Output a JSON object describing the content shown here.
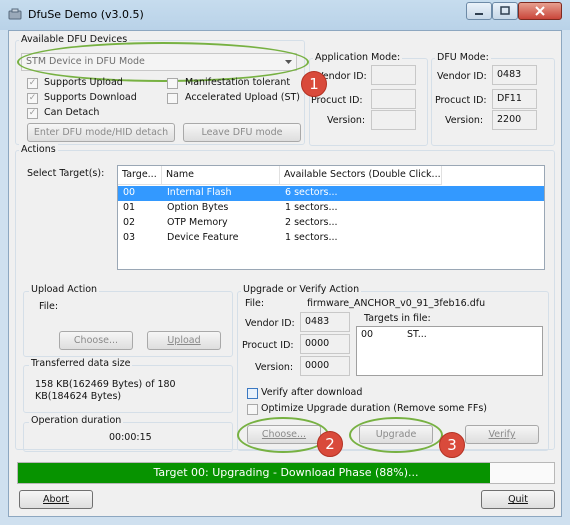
{
  "window": {
    "title": "DfuSe Demo (v3.0.5)"
  },
  "dfu_devices": {
    "group_title": "Available DFU Devices",
    "selected_device": "STM Device in DFU Mode",
    "supports_upload": "Supports Upload",
    "supports_download": "Supports Download",
    "can_detach": "Can Detach",
    "manifestation_tolerant": "Manifestation tolerant",
    "accelerated_upload": "Accelerated Upload (ST)",
    "enter_dfu_button": "Enter DFU mode/HID detach",
    "leave_dfu_button": "Leave DFU mode"
  },
  "application_mode": {
    "title": "Application Mode:",
    "vendor_id_label": "Vendor ID:",
    "product_id_label": "Procuct ID:",
    "version_label": "Version:",
    "vendor_id": "",
    "product_id": "",
    "version": ""
  },
  "dfu_mode": {
    "title": "DFU Mode:",
    "vendor_id_label": "Vendor ID:",
    "product_id_label": "Procuct ID:",
    "version_label": "Version:",
    "vendor_id": "0483",
    "product_id": "DF11",
    "version": "2200"
  },
  "actions": {
    "group_title": "Actions",
    "select_target_label": "Select Target(s):",
    "columns": [
      "Targe...",
      "Name",
      "Available Sectors (Double Click..."
    ],
    "targets": [
      {
        "id": "00",
        "name": "Internal Flash",
        "sectors": "6 sectors..."
      },
      {
        "id": "01",
        "name": "Option Bytes",
        "sectors": "1 sectors..."
      },
      {
        "id": "02",
        "name": "OTP Memory",
        "sectors": "2 sectors..."
      },
      {
        "id": "03",
        "name": "Device Feature",
        "sectors": "1 sectors..."
      }
    ]
  },
  "upload": {
    "group_title": "Upload Action",
    "file_label": "File:",
    "choose_button": "Choose...",
    "upload_button": "Upload"
  },
  "transferred": {
    "group_title": "Transferred data size",
    "text": "158 KB(162469 Bytes) of 180 KB(184624 Bytes)"
  },
  "duration": {
    "group_title": "Operation duration",
    "value": "00:00:15"
  },
  "upgrade": {
    "group_title": "Upgrade or Verify Action",
    "file_label": "File:",
    "file_name": "firmware_ANCHOR_v0_91_3feb16.dfu",
    "vendor_id_label": "Vendor ID:",
    "vendor_id": "0483",
    "product_id_label": "Procuct ID:",
    "product_id": "0000",
    "version_label": "Version:",
    "version": "0000",
    "targets_in_file_label": "Targets in file:",
    "targets_in_file": [
      {
        "id": "00",
        "name": "ST..."
      }
    ],
    "verify_after_download": "Verify after download",
    "optimize_upgrade": "Optimize Upgrade duration (Remove some FFs)",
    "choose_button": "Choose...",
    "upgrade_button": "Upgrade",
    "verify_button": "Verify"
  },
  "progress": {
    "text": "Target 00: Upgrading - Download Phase (88%)...",
    "percent": 88
  },
  "footer": {
    "abort_button": "Abort",
    "quit_button": "Quit"
  },
  "annotations": [
    "1",
    "2",
    "3"
  ],
  "colors": {
    "progress_green": "#079300",
    "annotation_red": "#d94a3b",
    "highlight_green": "#77b142",
    "selection_blue": "#3399ff"
  }
}
